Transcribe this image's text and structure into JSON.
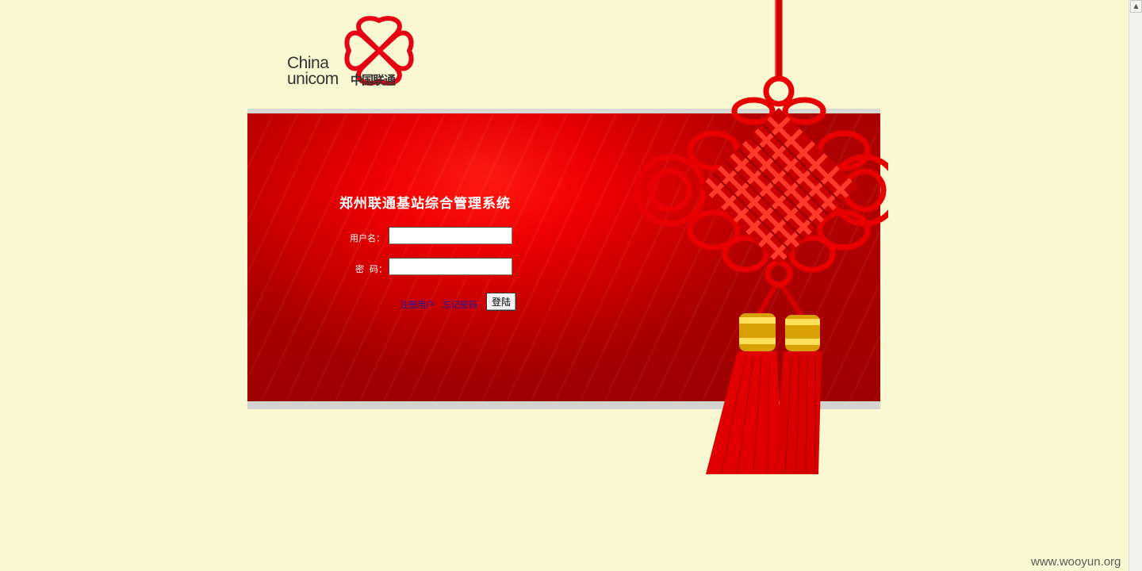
{
  "logo": {
    "english_line1": "China",
    "english_line2": "unicom",
    "chinese": "中国联通",
    "brand_color": "#e60012"
  },
  "login": {
    "system_title": "郑州联通基站综合管理系统",
    "username_label": "用户名：",
    "username_value": "",
    "password_label": "密  码：",
    "password_value": "",
    "register_link": "注册用户",
    "forgot_link": "忘记密码",
    "submit_label": "登陆"
  },
  "colors": {
    "page_background": "#f9f8d2",
    "banner_red": "#e00000",
    "link_blue": "#1a1aa0"
  },
  "decorations": {
    "knot_icon": "chinese-knot-icon",
    "logo_icon": "unicom-knot-logo-icon"
  },
  "watermark": "www.wooyun.org"
}
